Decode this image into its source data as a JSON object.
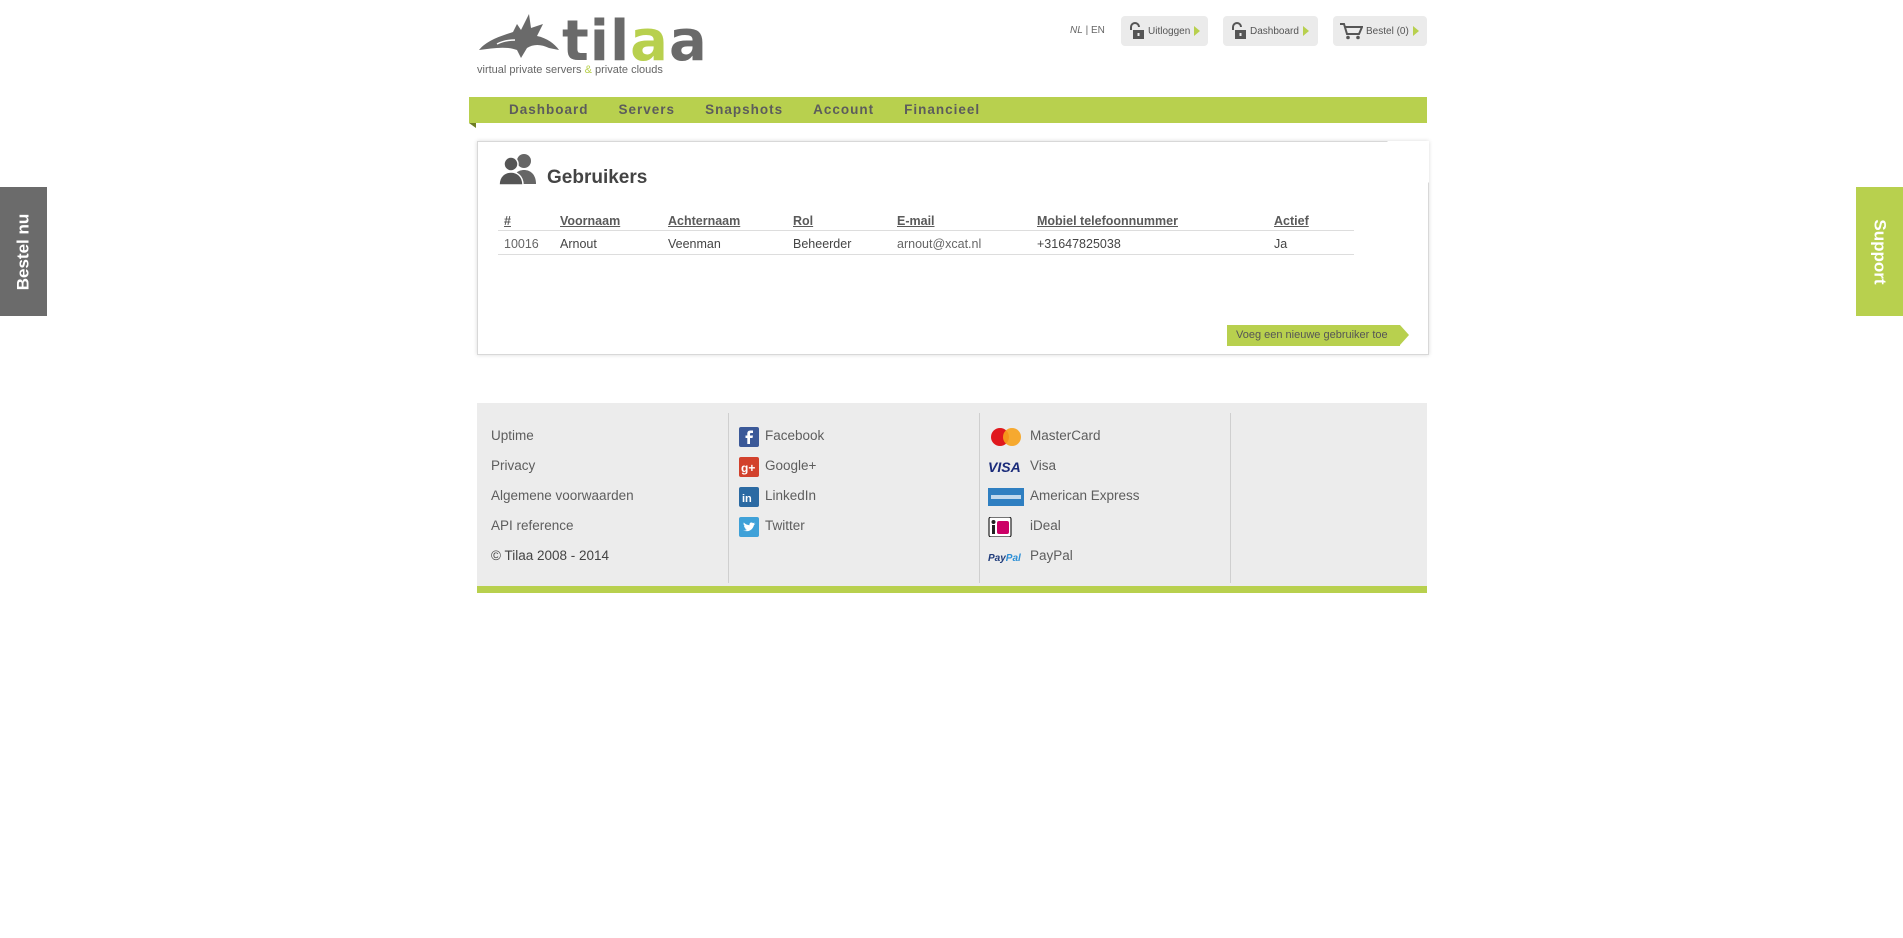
{
  "side_tabs": {
    "left": "Bestel nu",
    "right": "Support"
  },
  "logo": {
    "brand_part1": "til",
    "brand_accent": "a",
    "brand_part2": "a",
    "tagline_part1": "virtual private servers ",
    "tagline_amp": "&",
    "tagline_part2": " private clouds"
  },
  "lang": {
    "nl": "NL",
    "sep": " | ",
    "en": "EN"
  },
  "header_buttons": {
    "logout": "Uitloggen",
    "dashboard": "Dashboard",
    "order": "Bestel (0)"
  },
  "nav": [
    "Dashboard",
    "Servers",
    "Snapshots",
    "Account",
    "Financieel"
  ],
  "panel": {
    "title": "Gebruikers",
    "columns": [
      "#",
      "Voornaam",
      "Achternaam",
      "Rol",
      "E-mail",
      "Mobiel telefoonnummer",
      "Actief"
    ],
    "rows": [
      {
        "id": "10016",
        "first": "Arnout",
        "last": "Veenman",
        "role": "Beheerder",
        "email": "arnout@xcat.nl",
        "mobile": "+31647825038",
        "active": "Ja"
      }
    ],
    "add_button": "Voeg een nieuwe gebruiker toe"
  },
  "footer": {
    "links": [
      "Uptime",
      "Privacy",
      "Algemene voorwaarden",
      "API reference"
    ],
    "copyright": "© Tilaa 2008 - 2014",
    "social": [
      {
        "label": "Facebook",
        "icon": "facebook-icon"
      },
      {
        "label": "Google+",
        "icon": "google-plus-icon"
      },
      {
        "label": "LinkedIn",
        "icon": "linkedin-icon"
      },
      {
        "label": "Twitter",
        "icon": "twitter-icon"
      }
    ],
    "payments": [
      {
        "label": "MasterCard",
        "icon": "mastercard-icon"
      },
      {
        "label": "Visa",
        "icon": "visa-icon"
      },
      {
        "label": "American Express",
        "icon": "amex-icon"
      },
      {
        "label": "iDeal",
        "icon": "ideal-icon"
      },
      {
        "label": "PayPal",
        "icon": "paypal-icon"
      }
    ]
  },
  "colors": {
    "accent": "#b8d04e",
    "dark_tab": "#6b6b6b",
    "footer_bg": "#ececec"
  }
}
